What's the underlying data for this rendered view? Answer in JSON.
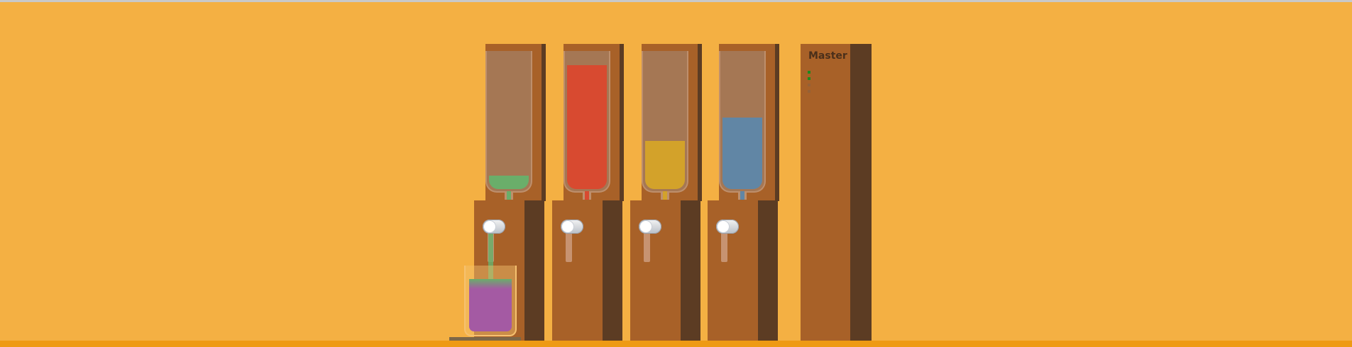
{
  "scene": {
    "background": "#F4B043",
    "floor_color": "#EE9A14",
    "wood_front": "#A86128",
    "wood_side": "#5C3C23"
  },
  "dispensers": [
    {
      "name": "green",
      "color": "#6AAE6A",
      "fill_level": 0.1,
      "pouring": true
    },
    {
      "name": "red",
      "color": "#D84A30",
      "fill_level": 0.9,
      "pouring": false
    },
    {
      "name": "yellow",
      "color": "#D3A22A",
      "fill_level": 0.35,
      "pouring": false
    },
    {
      "name": "blue",
      "color": "#6186A5",
      "fill_level": 0.52,
      "pouring": false
    }
  ],
  "glass": {
    "fill_level": 0.78,
    "mix_color": "#A45AA3",
    "top_layer_color": "#6AAE6A"
  },
  "master": {
    "label": "Master",
    "indicators": [
      {
        "on": true,
        "color": "#1E8A1E"
      },
      {
        "on": true,
        "color": "#1E8A1E"
      },
      {
        "on": false,
        "color": "#8A6040"
      },
      {
        "on": false,
        "color": "#8A6040"
      }
    ]
  }
}
